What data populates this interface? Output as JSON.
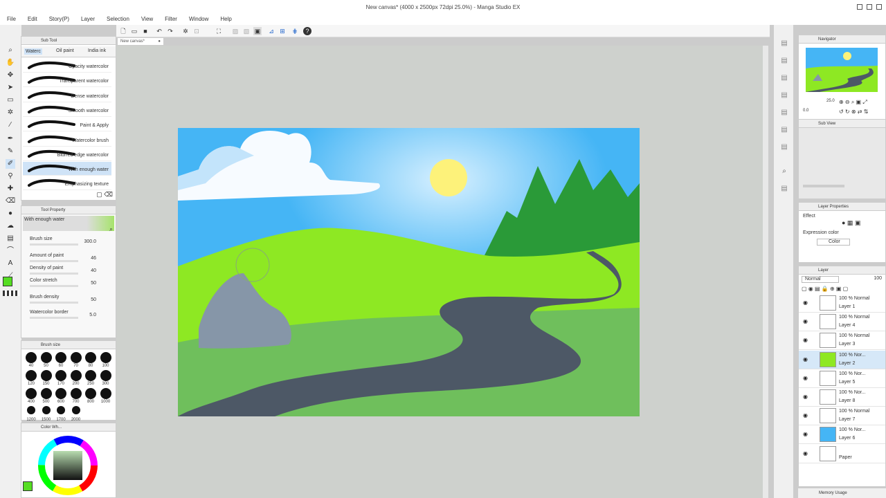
{
  "window": {
    "title": "New canvas* (4000 x 2500px 72dpi 25.0%) - Manga Studio EX"
  },
  "menu": [
    "File",
    "Edit",
    "Story(P)",
    "Layer",
    "Selection",
    "View",
    "Filter",
    "Window",
    "Help"
  ],
  "document_tab": "New canvas*",
  "subtool": {
    "header": "Sub Tool",
    "tabs": [
      "Waterc",
      "Oil paint",
      "India ink"
    ],
    "brushes": [
      "Opacity watercolor",
      "Transparent watercolor",
      "Dense watercolor",
      "Smooth watercolor",
      "Paint & Apply",
      "Watercolor brush",
      "Blurred edge watercolor",
      "With enough water",
      "Emphasizing texture"
    ]
  },
  "tool_property": {
    "header": "Tool Property",
    "current": "With enough water",
    "props": [
      {
        "label": "Brush size",
        "value": "300.0"
      },
      {
        "label": "Amount of paint",
        "value": "46"
      },
      {
        "label": "Density of paint",
        "value": "40"
      },
      {
        "label": "Color stretch",
        "value": "50"
      },
      {
        "label": "Brush density",
        "value": "50"
      },
      {
        "label": "Watercolor border",
        "value": "5.0"
      }
    ]
  },
  "brush_size": {
    "header": "Brush size",
    "sizes": [
      "40",
      "50",
      "60",
      "70",
      "80",
      "100",
      "120",
      "150",
      "170",
      "200",
      "250",
      "300",
      "400",
      "500",
      "600",
      "700",
      "800",
      "1000",
      "1200",
      "1500",
      "1700",
      "2000"
    ]
  },
  "color_wheel": {
    "header": "Color Wh..."
  },
  "navigator": {
    "header": "Navigator",
    "zoom": "25.0",
    "rotate": "0.0"
  },
  "subview": {
    "header": "Sub View"
  },
  "layer_property": {
    "header": "Layer Properties",
    "effect": "Effect",
    "expression_label": "Expression color",
    "expression_value": "Color"
  },
  "layer_panel": {
    "header": "Layer",
    "blend": "Normal",
    "opacity": "100",
    "layers": [
      {
        "opacity": "100 %",
        "blend": "Normal",
        "name": "Layer 1"
      },
      {
        "opacity": "100 %",
        "blend": "Normal",
        "name": "Layer 4"
      },
      {
        "opacity": "100 %",
        "blend": "Normal",
        "name": "Layer 3"
      },
      {
        "opacity": "100 %",
        "blend": "Nor...",
        "name": "Layer 2"
      },
      {
        "opacity": "100 %",
        "blend": "Nor...",
        "name": "Layer 5"
      },
      {
        "opacity": "100 %",
        "blend": "Nor...",
        "name": "Layer 8"
      },
      {
        "opacity": "100 %",
        "blend": "Normal",
        "name": "Layer 7"
      },
      {
        "opacity": "100 %",
        "blend": "Nor...",
        "name": "Layer 6"
      },
      {
        "opacity": "",
        "blend": "",
        "name": "Paper"
      }
    ]
  },
  "memory": "Memory Usage",
  "colors": {
    "sky": "#45b5f5",
    "grass_light": "#8ee823",
    "grass_dark": "#6fbf5c",
    "road": "#4d5866",
    "tree": "#2a9a38",
    "sun": "#fdf27a",
    "main_color": "#55dd22"
  }
}
